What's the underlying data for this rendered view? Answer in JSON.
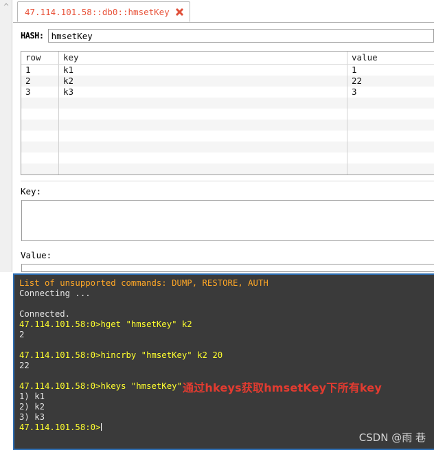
{
  "window": {
    "title": "47.114.101.58::db0::hmsetKey"
  },
  "tab": {
    "label": "47.114.101.58::db0::hmsetKey",
    "close_icon": "close-x-icon",
    "accent_color": "#e8533a"
  },
  "gutter": {
    "scroll_up_icon": "chevron-up-icon"
  },
  "hash_field": {
    "label": "HASH:",
    "value": "hmsetKey",
    "placeholder": ""
  },
  "table": {
    "headers": [
      "row",
      "key",
      "value"
    ],
    "rows": [
      {
        "row": "1",
        "key": "k1",
        "value": "1"
      },
      {
        "row": "2",
        "key": "k2",
        "value": "22"
      },
      {
        "row": "3",
        "key": "k3",
        "value": "3"
      }
    ],
    "empty_filler_rows": 9
  },
  "key_pane": {
    "label": "Key:",
    "value": ""
  },
  "value_pane": {
    "label": "Value:",
    "value": ""
  },
  "console": {
    "background_color": "#3a3a3a",
    "border_color": "#2b6db3",
    "lines": [
      {
        "text": "List of unsupported commands: DUMP, RESTORE, AUTH",
        "color": "orange"
      },
      {
        "text": "Connecting ...",
        "color": "white"
      },
      {
        "text": "",
        "color": "white"
      },
      {
        "text": "Connected.",
        "color": "white"
      },
      {
        "text": "47.114.101.58:0>hget \"hmsetKey\" k2",
        "color": "yellow"
      },
      {
        "text": "2",
        "color": "white"
      },
      {
        "text": "",
        "color": "white"
      },
      {
        "text": "47.114.101.58:0>hincrby \"hmsetKey\" k2 20",
        "color": "yellow"
      },
      {
        "text": "22",
        "color": "white"
      },
      {
        "text": "",
        "color": "white"
      },
      {
        "text": "47.114.101.58:0>hkeys \"hmsetKey\"",
        "color": "yellow"
      },
      {
        "text": "1) k1",
        "color": "white"
      },
      {
        "text": "2) k2",
        "color": "white"
      },
      {
        "text": "3) k3",
        "color": "white"
      },
      {
        "text": "47.114.101.58:0>",
        "color": "yellow",
        "caret": true
      }
    ]
  },
  "annotation": {
    "text": "通过hkeys获取hmsetKey下所有key",
    "color": "#e23b30"
  },
  "watermark": {
    "text": "CSDN @雨 巷"
  }
}
